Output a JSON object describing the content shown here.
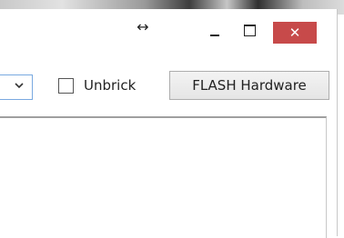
{
  "window": {
    "controls": {
      "resize_glyph": "↔",
      "minimize_icon": "minimize-icon",
      "maximize_icon": "maximize-icon",
      "close_glyph": "✕"
    }
  },
  "toolbar": {
    "unbrick_label": "Unbrick",
    "unbrick_checked": false,
    "flash_button_label": "FLASH Hardware"
  },
  "colors": {
    "close_button": "#c74a4a",
    "combo_border": "#79a9e0"
  }
}
